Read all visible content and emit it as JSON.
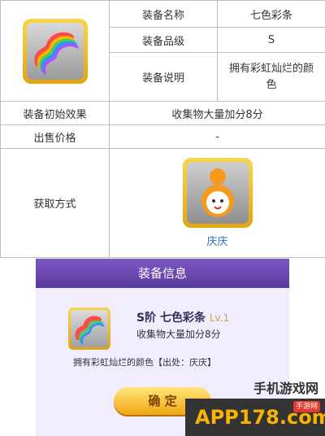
{
  "equip": {
    "name_label": "装备名称",
    "name_value": "七色彩条",
    "grade_label": "装备品级",
    "grade_value": "S",
    "desc_label": "装备说明",
    "desc_value": "拥有彩虹灿烂的颜色",
    "effect_label": "装备初始效果",
    "effect_value": "收集物大量加分8分",
    "price_label": "出售价格",
    "price_value": "-",
    "obtain_label": "获取方式",
    "obtain_pet": "庆庆"
  },
  "game_popup": {
    "header": "装备信息",
    "item_title": "S阶 七色彩条",
    "item_level": "Lv.1",
    "item_desc": "收集物大量加分8分",
    "detail_line": "拥有彩虹灿烂的颜色【出处：庆庆】",
    "confirm_label": "确 定"
  },
  "watermark": {
    "text_cn": "手机游戏网",
    "brand": "APP178.com",
    "tag": "手游网"
  }
}
